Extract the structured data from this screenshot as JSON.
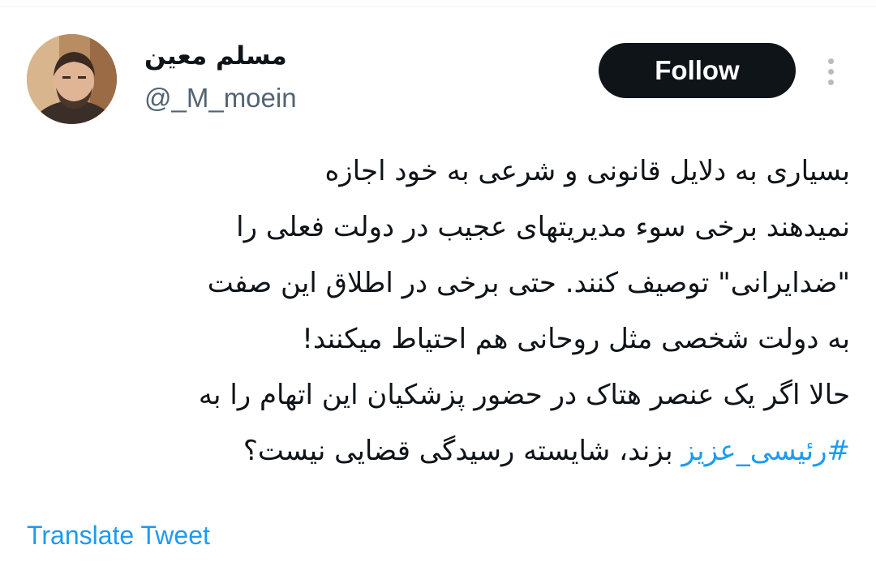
{
  "author": {
    "display_name": "مسلم معین",
    "handle": "@_M_moein"
  },
  "follow_button": {
    "label": "Follow"
  },
  "more_menu": {
    "icon": "more-vertical-icon"
  },
  "tweet": {
    "lines": [
      "بسیاری به دلایل قانونی و شرعی به خود اجازه",
      "نمیدهند برخی سوء مدیریتهای عجیب در دولت فعلی را",
      "\"ضدایرانی\" توصیف کنند. حتی برخی در اطلاق این صفت",
      "به دولت شخصی مثل روحانی هم احتیاط میکنند!",
      "حالا اگر یک عنصر هتاک در حضور پزشکیان این اتهام را به"
    ],
    "last_line": {
      "hashtag": "#رئیسی_عزیز",
      "rest": " بزند، شایسته رسیدگی قضایی نیست؟"
    }
  },
  "translate_link": "Translate Tweet",
  "colors": {
    "link": "#1d9bf0",
    "text": "#0f1419",
    "secondary": "#536471",
    "button_bg": "#0f1419"
  }
}
